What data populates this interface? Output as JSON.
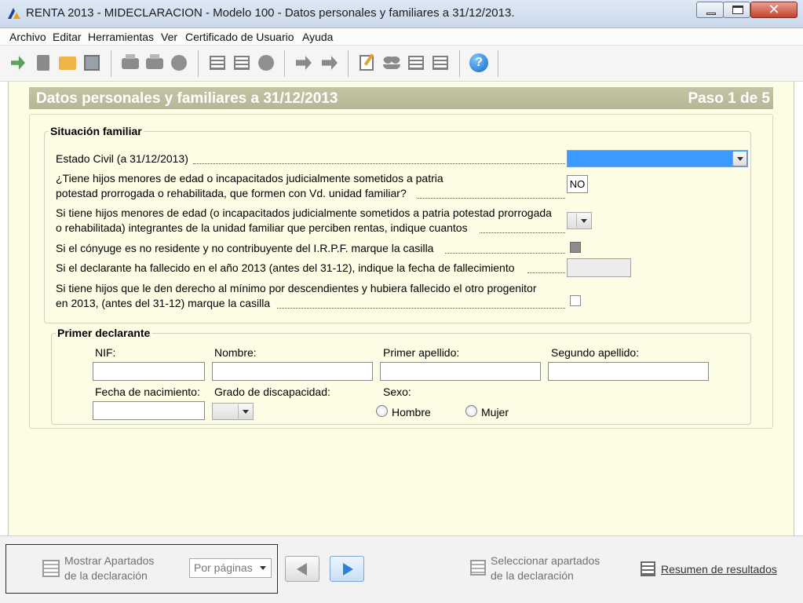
{
  "window": {
    "title": "RENTA 2013 - MIDECLARACION - Modelo 100 - Datos personales y familiares a 31/12/2013.",
    "close_label": "✕"
  },
  "menu": [
    "Archivo",
    "Editar",
    "Herramientas",
    "Ver",
    "Certificado de Usuario",
    "Ayuda"
  ],
  "toolbar": {
    "icons": [
      "exit-icon",
      "new-document-icon",
      "open-folder-icon",
      "save-icon",
      "print-icon",
      "print-preview-icon",
      "send-icon",
      "validate-icon",
      "calculator-icon",
      "info-icon",
      "forward-icon",
      "next-document-icon",
      "edit-icon",
      "people-icon",
      "list-icon",
      "table-icon",
      "help-icon"
    ],
    "help_glyph": "?"
  },
  "section": {
    "title": "Datos personales y familiares a 31/12/2013",
    "step": "Paso 1 de 5"
  },
  "situacion_familiar": {
    "title": "Situación familiar",
    "q_estado_civil": "Estado Civil (a 31/12/2013)",
    "q_hijos_1": "¿Tiene hijos menores de edad o incapacitados judicialmente sometidos a patria",
    "q_hijos_2": "potestad prorrogada o rehabilitada, que formen con Vd. unidad familiar?",
    "hijos_value": "NO",
    "q_rentas_1": "Si tiene hijos menores de edad (o incapacitados judicialmente sometidos a patria potestad prorrogada",
    "q_rentas_2": "o rehabilitada) integrantes de la unidad familiar que perciben rentas, indique cuantos",
    "q_conyuge": "Si el cónyuge es no residente y no contribuyente del I.R.P.F. marque la casilla",
    "q_fallecido": "Si el declarante ha fallecido en el año 2013 (antes del 31-12), indique la fecha de fallecimiento",
    "q_progenitor_1": "Si tiene hijos que le den derecho al mínimo por descendientes y hubiera fallecido el otro progenitor",
    "q_progenitor_2": "en 2013, (antes del 31-12) marque la casilla"
  },
  "primer_declarante": {
    "title": "Primer declarante",
    "nif_label": "NIF:",
    "nombre_label": "Nombre:",
    "primer_apellido_label": "Primer apellido:",
    "segundo_apellido_label": "Segundo apellido:",
    "fecha_label": "Fecha de nacimiento:",
    "discapacidad_label": "Grado de discapacidad:",
    "sexo_label": "Sexo:",
    "hombre_label": "Hombre",
    "mujer_label": "Mujer"
  },
  "footer": {
    "mostrar_1": "Mostrar Apartados",
    "mostrar_2": "de la declaración",
    "pager_value": "Por páginas",
    "seleccionar_1": "Seleccionar apartados",
    "seleccionar_2": "de la declaración",
    "resumen": "Resumen de resultados"
  },
  "colors": {
    "content_bg": "#fdfde6",
    "section_bar": "#bfbf9f",
    "selected_blue": "#3a9aff"
  }
}
